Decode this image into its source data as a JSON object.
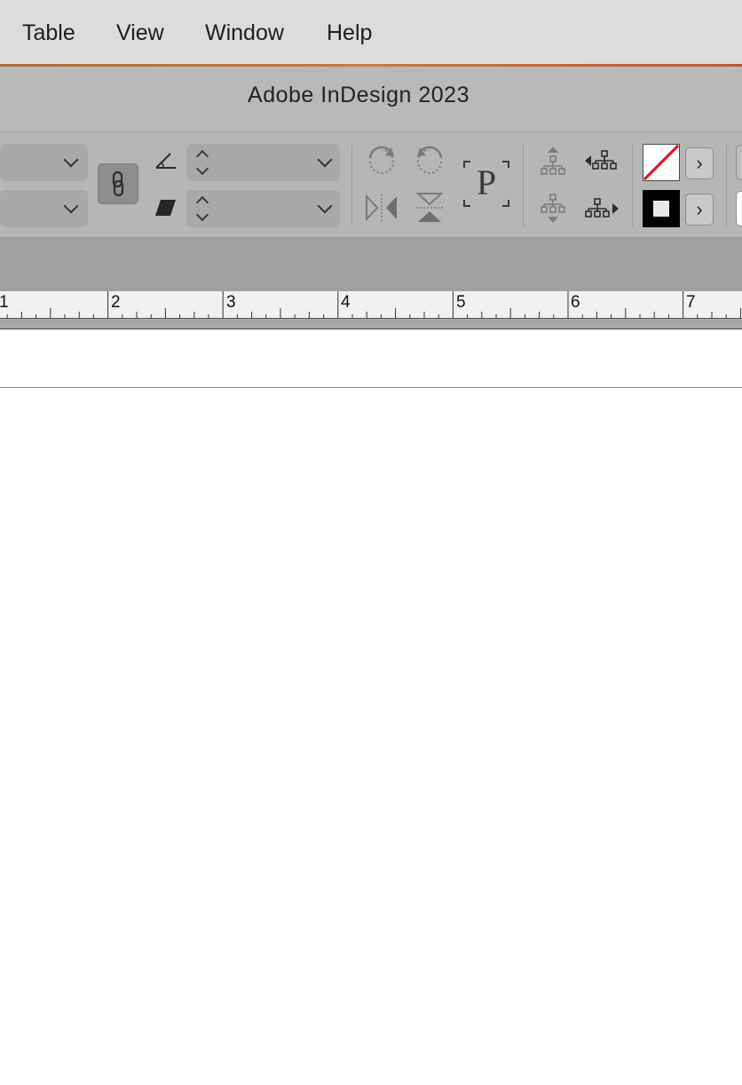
{
  "menubar": {
    "items": [
      {
        "label": "Table"
      },
      {
        "label": "View"
      },
      {
        "label": "Window"
      },
      {
        "label": "Help"
      }
    ]
  },
  "titlebar": {
    "title": "Adobe InDesign 2023"
  },
  "control_panel": {
    "fill_swatch_icon": "none-swatch-icon",
    "stroke_swatch_icon": "black-stroke-swatch-icon",
    "arrow_glyph": "›",
    "proxy_glyph": "P"
  },
  "ruler": {
    "numbers": [
      "1",
      "2",
      "3",
      "4",
      "5",
      "6",
      "7"
    ]
  },
  "colors": {
    "margin_guide": "#e44fe6",
    "menu_accent": "#c67a3c"
  }
}
